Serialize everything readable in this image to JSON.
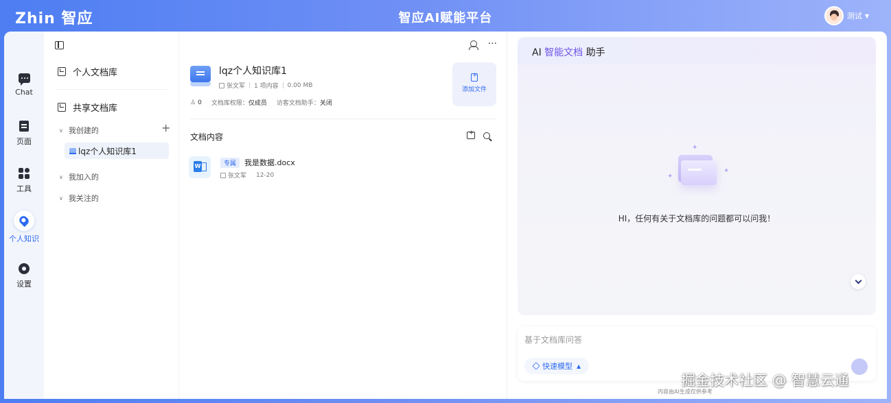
{
  "header": {
    "logo": "Zhin 智应",
    "platform_title": "智应AI赋能平台",
    "user_name": "测试"
  },
  "rail": {
    "items": [
      {
        "label": "Chat",
        "icon": "chat-icon"
      },
      {
        "label": "页面",
        "icon": "page-icon"
      },
      {
        "label": "工具",
        "icon": "tools-icon"
      },
      {
        "label": "个人知识",
        "icon": "knowledge-icon"
      },
      {
        "label": "设置",
        "icon": "gear-icon"
      }
    ],
    "active": "个人知识"
  },
  "kb_panel": {
    "personal_label": "个人文档库",
    "shared_label": "共享文档库",
    "groups": [
      {
        "label": "我创建的"
      },
      {
        "label": "我加入的"
      },
      {
        "label": "我关注的"
      }
    ],
    "selected_kb": "lqz个人知识库1"
  },
  "kb_detail": {
    "title": "lqz个人知识库1",
    "owner": "张文军",
    "item_count": "1 项内容",
    "size": "0.00 MB",
    "members": "0",
    "permission_label": "文档库权限：",
    "permission_value": "仅成员",
    "visitor_label": "访客文档助手：",
    "visitor_value": "关闭",
    "add_file_label": "添加文件"
  },
  "docs": {
    "section_label": "文档内容",
    "files": [
      {
        "tag": "专属",
        "name": "我是数据.docx",
        "owner": "张文军",
        "date": "12-20"
      }
    ]
  },
  "ai": {
    "title_prefix": "AI ",
    "title_highlight": "智能文档",
    "title_suffix": " 助手",
    "hint": "HI，任何有关于文档库的问题都可以问我！",
    "input_placeholder": "基于文档库问答",
    "model_label": "快速模型",
    "disclaimer": "内容由AI生成仅供参考",
    "accent_color": "#6e55e6"
  },
  "watermark": "掘金技术社区 @ 智慧云通"
}
